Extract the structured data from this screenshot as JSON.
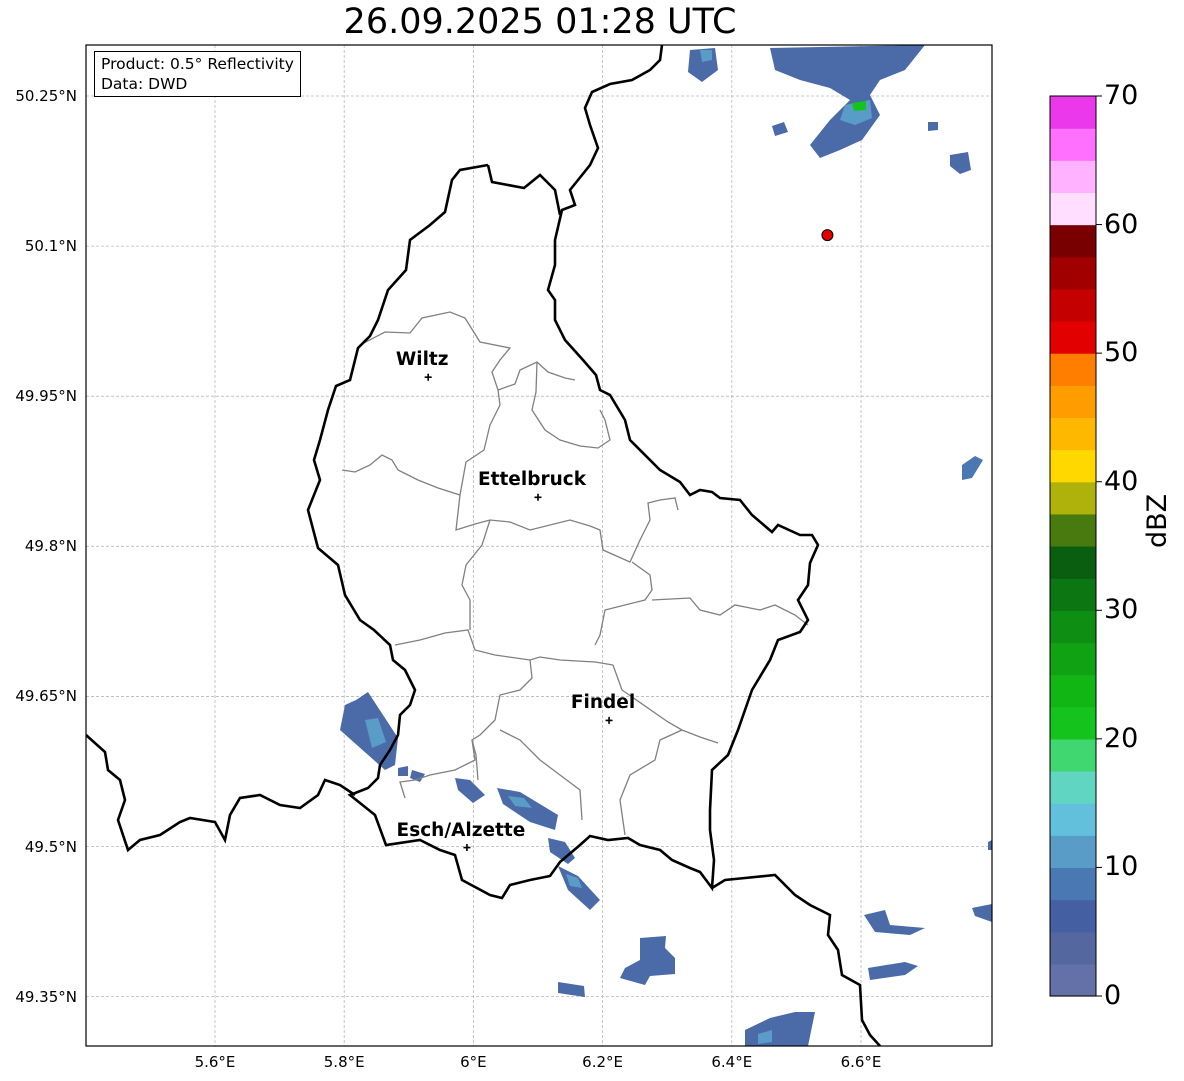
{
  "title": "26.09.2025 01:28 UTC",
  "info": {
    "product": "Product: 0.5° Reflectivity",
    "data": "Data: DWD"
  },
  "lat_ticks": [
    {
      "value": 50.25,
      "label": "50.25°N"
    },
    {
      "value": 50.1,
      "label": "50.1°N"
    },
    {
      "value": 49.95,
      "label": "49.95°N"
    },
    {
      "value": 49.8,
      "label": "49.8°N"
    },
    {
      "value": 49.65,
      "label": "49.65°N"
    },
    {
      "value": 49.5,
      "label": "49.5°N"
    },
    {
      "value": 49.35,
      "label": "49.35°N"
    }
  ],
  "lon_ticks": [
    {
      "value": 5.6,
      "label": "5.6°E"
    },
    {
      "value": 5.8,
      "label": "5.8°E"
    },
    {
      "value": 6.0,
      "label": "6°E"
    },
    {
      "value": 6.2,
      "label": "6.2°E"
    },
    {
      "value": 6.4,
      "label": "6.4°E"
    },
    {
      "value": 6.6,
      "label": "6.6°E"
    }
  ],
  "cities": [
    {
      "name": "Wiltz",
      "lon": 5.93,
      "lat": 49.969
    },
    {
      "name": "Ettelbruck",
      "lon": 6.1,
      "lat": 49.849
    },
    {
      "name": "Findel",
      "lon": 6.21,
      "lat": 49.626
    },
    {
      "name": "Esch/Alzette",
      "lon": 5.99,
      "lat": 49.499
    }
  ],
  "radar_site": {
    "lon": 6.548,
    "lat": 50.111,
    "color": "#e00000"
  },
  "colorbar": {
    "label": "dBZ",
    "ticks": [
      0,
      10,
      20,
      30,
      40,
      50,
      60,
      70
    ],
    "min": 0,
    "max": 70,
    "step": 2.5,
    "colors": [
      "#6471a8",
      "#54689f",
      "#4460a3",
      "#4a78b2",
      "#5a9cc8",
      "#62c0dc",
      "#60d6c2",
      "#40d670",
      "#14c41c",
      "#12b614",
      "#10a212",
      "#0e8e12",
      "#0b7612",
      "#095e10",
      "#487a10",
      "#b0b20c",
      "#ffd800",
      "#ffb800",
      "#ff9c00",
      "#ff7e00",
      "#e20000",
      "#c40000",
      "#a00000",
      "#780000",
      "#ffdeff",
      "#ffb2ff",
      "#ff70ff",
      "#ea38ea"
    ]
  },
  "map": {
    "grid": true,
    "colors": {
      "country_border": "#000000",
      "canton_border": "#808080",
      "gridline": "#b8b8b8"
    }
  }
}
